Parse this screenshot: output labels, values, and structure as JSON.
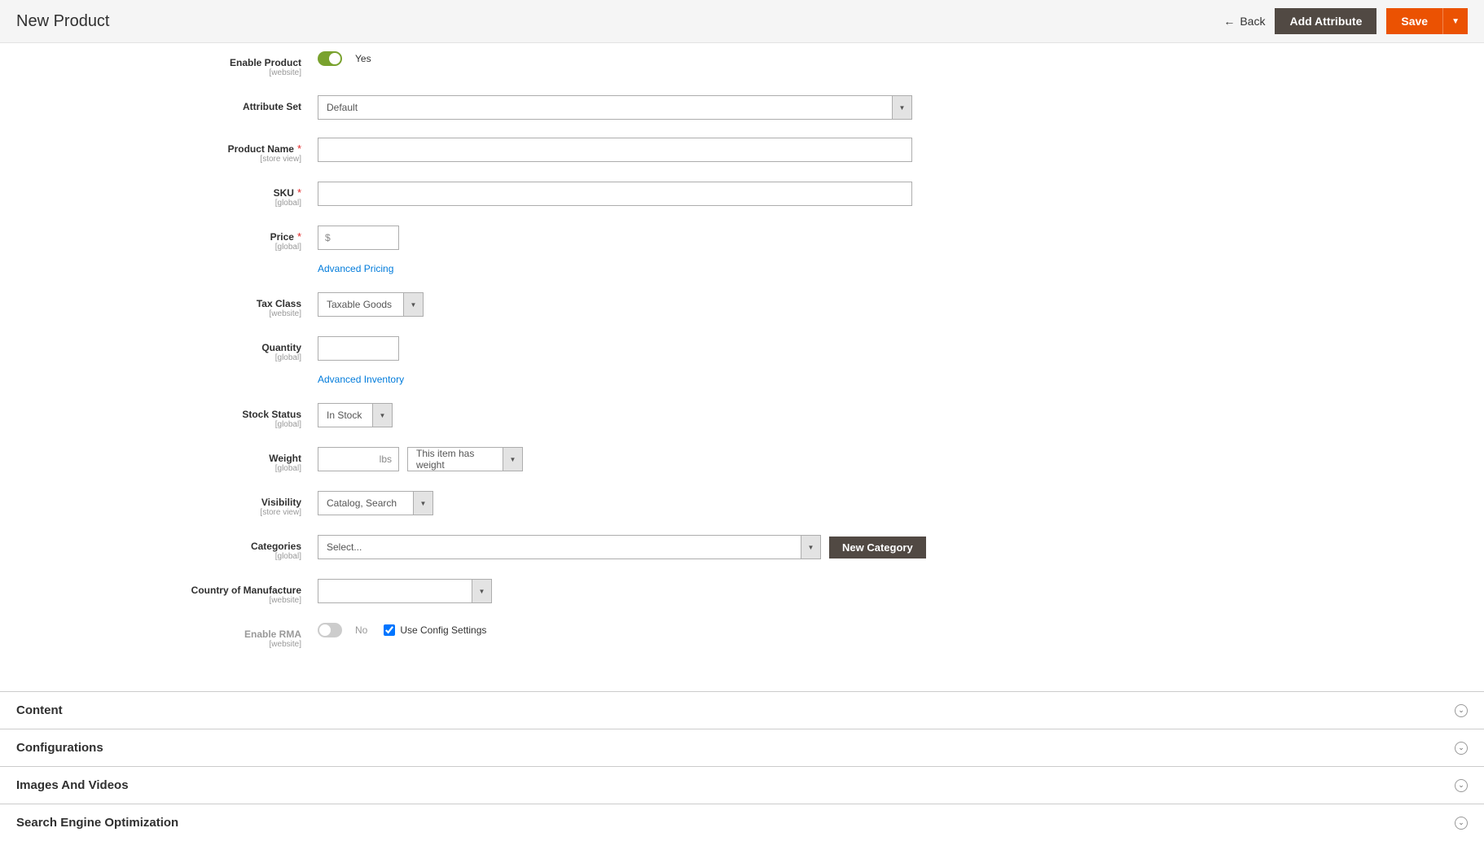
{
  "header": {
    "title": "New Product",
    "back": "Back",
    "add_attribute": "Add Attribute",
    "save": "Save"
  },
  "form": {
    "enable_product": {
      "label": "Enable Product",
      "scope": "[website]",
      "value": "Yes"
    },
    "attribute_set": {
      "label": "Attribute Set",
      "value": "Default"
    },
    "product_name": {
      "label": "Product Name",
      "scope": "[store view]",
      "value": ""
    },
    "sku": {
      "label": "SKU",
      "scope": "[global]",
      "value": ""
    },
    "price": {
      "label": "Price",
      "scope": "[global]",
      "currency": "$",
      "value": "",
      "advanced_link": "Advanced Pricing"
    },
    "tax_class": {
      "label": "Tax Class",
      "scope": "[website]",
      "value": "Taxable Goods"
    },
    "quantity": {
      "label": "Quantity",
      "scope": "[global]",
      "value": "",
      "advanced_link": "Advanced Inventory"
    },
    "stock_status": {
      "label": "Stock Status",
      "scope": "[global]",
      "value": "In Stock"
    },
    "weight": {
      "label": "Weight",
      "scope": "[global]",
      "value": "",
      "unit": "lbs",
      "type_value": "This item has weight"
    },
    "visibility": {
      "label": "Visibility",
      "scope": "[store view]",
      "value": "Catalog, Search"
    },
    "categories": {
      "label": "Categories",
      "scope": "[global]",
      "placeholder": "Select...",
      "new_btn": "New Category"
    },
    "country": {
      "label": "Country of Manufacture",
      "scope": "[website]",
      "value": ""
    },
    "enable_rma": {
      "label": "Enable RMA",
      "scope": "[website]",
      "value": "No",
      "use_config": "Use Config Settings"
    }
  },
  "sections": [
    {
      "title": "Content"
    },
    {
      "title": "Configurations"
    },
    {
      "title": "Images And Videos"
    },
    {
      "title": "Search Engine Optimization"
    }
  ]
}
